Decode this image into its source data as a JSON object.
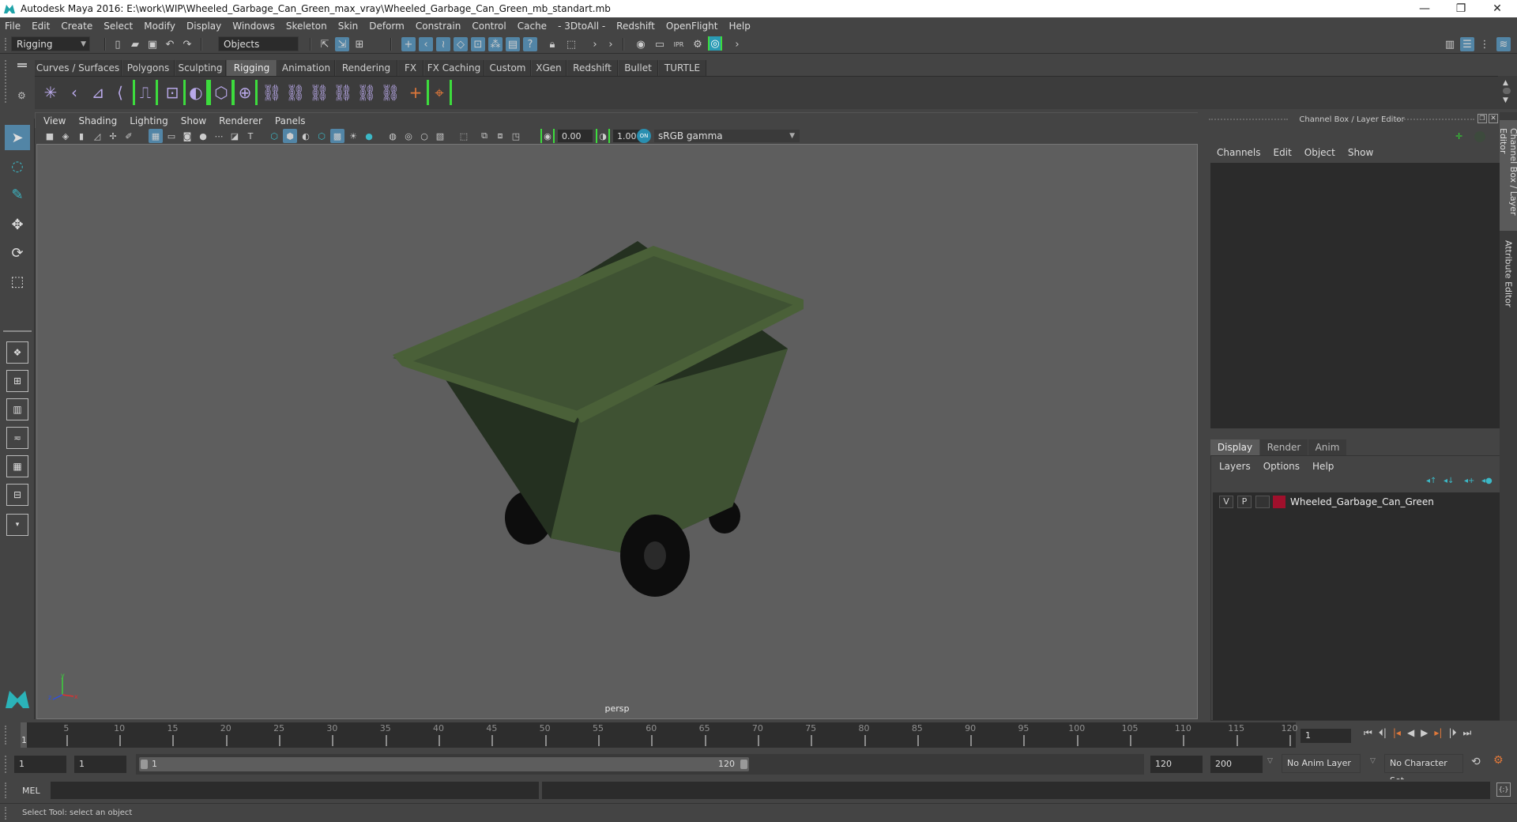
{
  "window": {
    "title": "Autodesk Maya 2016: E:\\work\\WIP\\Wheeled_Garbage_Can_Green_max_vray\\Wheeled_Garbage_Can_Green_mb_standart.mb",
    "controls": {
      "minimize": "—",
      "restore": "❐",
      "close": "✕"
    }
  },
  "menubar": [
    "File",
    "Edit",
    "Create",
    "Select",
    "Modify",
    "Display",
    "Windows",
    "Skeleton",
    "Skin",
    "Deform",
    "Constrain",
    "Control",
    "Cache",
    "- 3DtoAll -",
    "Redshift",
    "OpenFlight",
    "Help"
  ],
  "statusline": {
    "menu_set": "Rigging",
    "selection_mode": "Objects"
  },
  "shelf": {
    "tabs": [
      {
        "label": "Curves / Surfaces",
        "active": false
      },
      {
        "label": "Polygons",
        "active": false
      },
      {
        "label": "Sculpting",
        "active": false
      },
      {
        "label": "Rigging",
        "active": true
      },
      {
        "label": "Animation",
        "active": false
      },
      {
        "label": "Rendering",
        "active": false
      },
      {
        "label": "FX",
        "active": false
      },
      {
        "label": "FX Caching",
        "active": false
      },
      {
        "label": "Custom",
        "active": false
      },
      {
        "label": "XGen",
        "active": false
      },
      {
        "label": "Redshift",
        "active": false
      },
      {
        "label": "Bullet",
        "active": false
      },
      {
        "label": "TURTLE",
        "active": false
      }
    ],
    "icons": [
      "joint-tool",
      "ik-handle",
      "ik-spline",
      "create-ikspline",
      "humanik",
      "quick-rig",
      "smooth-bind",
      "rigid-bind",
      "interactive-skin-bind",
      "parent-constraint",
      "point-constraint",
      "orient-constraint",
      "scale-constraint",
      "aim-constraint",
      "pole-vector-constraint",
      "locator",
      "pin-locator"
    ]
  },
  "viewport": {
    "menu": [
      "View",
      "Shading",
      "Lighting",
      "Show",
      "Renderer",
      "Panels"
    ],
    "exposure": "0.00",
    "gamma": "1.00",
    "color_management": "ON",
    "color_space": "sRGB gamma",
    "camera_label": "persp",
    "axis": {
      "x": "x",
      "y": "y",
      "z": "z"
    },
    "model_colors": {
      "body": "#3f5233",
      "rim": "#4a6038",
      "shadow": "#243020",
      "wheel": "#0d0d0d"
    }
  },
  "channel_box": {
    "title": "Channel Box / Layer Editor",
    "menu": [
      "Channels",
      "Edit",
      "Object",
      "Show"
    ]
  },
  "layer_editor": {
    "tabs": [
      {
        "label": "Display",
        "active": true
      },
      {
        "label": "Render",
        "active": false
      },
      {
        "label": "Anim",
        "active": false
      }
    ],
    "menu": [
      "Layers",
      "Options",
      "Help"
    ],
    "layers": [
      {
        "visible": "V",
        "playback": "P",
        "name": "Wheeled_Garbage_Can_Green",
        "color": "#a0102c"
      }
    ]
  },
  "side_tabs": [
    "Channel Box / Layer Editor",
    "Attribute Editor"
  ],
  "timeline": {
    "start": 1,
    "end": 120,
    "current_frame": 1,
    "tick_labels": [
      "5",
      "10",
      "15",
      "20",
      "25",
      "30",
      "35",
      "40",
      "45",
      "50",
      "55",
      "60",
      "65",
      "70",
      "75",
      "80",
      "85",
      "90",
      "95",
      "100",
      "105",
      "110",
      "115",
      "120"
    ],
    "current_frame_field": "1"
  },
  "range": {
    "start_field": "1",
    "playback_start_field": "1",
    "slider_start": "1",
    "slider_end": "120",
    "playback_end_field": "120",
    "end_field": "200",
    "anim_layer": "No Anim Layer",
    "character_set": "No Character Set"
  },
  "command_line": {
    "language": "MEL",
    "value": ""
  },
  "help_line": "Select Tool: select an object",
  "colors": {
    "accent": "#5285a6",
    "highlight_green": "#3ddc3d",
    "key_orange": "#e0783a"
  }
}
